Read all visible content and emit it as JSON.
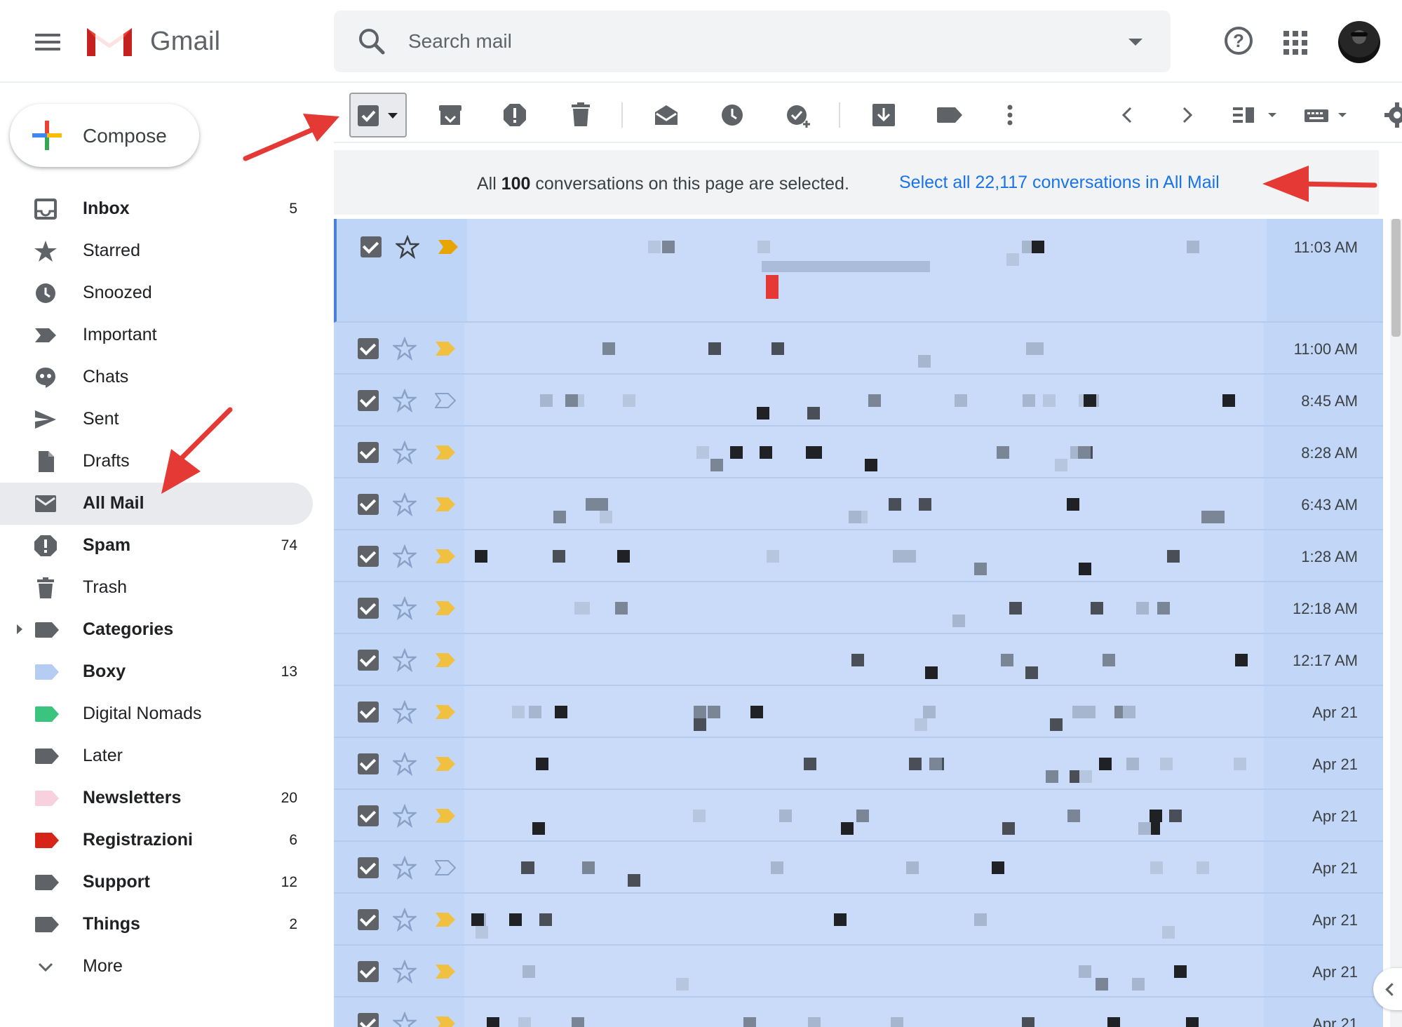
{
  "app": {
    "title": "Gmail"
  },
  "search": {
    "placeholder": "Search mail"
  },
  "compose": {
    "label": "Compose"
  },
  "sidebar": {
    "items": [
      {
        "label": "Inbox",
        "count": "5",
        "bold": true
      },
      {
        "label": "Starred",
        "count": ""
      },
      {
        "label": "Snoozed",
        "count": ""
      },
      {
        "label": "Important",
        "count": ""
      },
      {
        "label": "Chats",
        "count": ""
      },
      {
        "label": "Sent",
        "count": ""
      },
      {
        "label": "Drafts",
        "count": ""
      },
      {
        "label": "All Mail",
        "count": "",
        "bold": true,
        "active": true
      },
      {
        "label": "Spam",
        "count": "74",
        "bold": true
      },
      {
        "label": "Trash",
        "count": ""
      },
      {
        "label": "Categories",
        "count": "",
        "bold": true
      },
      {
        "label": "Boxy",
        "count": "13",
        "bold": true,
        "color": "#b5cdf3"
      },
      {
        "label": "Digital Nomads",
        "count": "",
        "color": "#3ac47d"
      },
      {
        "label": "Later",
        "count": "",
        "color": "#5f6368"
      },
      {
        "label": "Newsletters",
        "count": "20",
        "bold": true,
        "color": "#f7d1dd"
      },
      {
        "label": "Registrazioni",
        "count": "6",
        "bold": true,
        "color": "#d62518"
      },
      {
        "label": "Support",
        "count": "12",
        "bold": true,
        "color": "#5f6368"
      },
      {
        "label": "Things",
        "count": "2",
        "bold": true,
        "color": "#5f6368"
      },
      {
        "label": "More",
        "count": ""
      }
    ]
  },
  "toolbar": {
    "icons": [
      "select-all-checkbox",
      "archive-icon",
      "report-spam-icon",
      "delete-icon",
      "mark-read-icon",
      "snooze-icon",
      "add-to-tasks-icon",
      "move-to-icon",
      "label-icon",
      "more-icon",
      "newer-icon",
      "older-icon",
      "split-pane-icon",
      "input-tools-icon",
      "settings-icon"
    ]
  },
  "banner": {
    "prefix": "All ",
    "count": "100",
    "suffix": " conversations on this page are selected.",
    "select_all_link": "Select all 22,117 conversations in All Mail"
  },
  "messages": [
    {
      "time": "11:03 AM",
      "important": true,
      "important_color": "#e6a500"
    },
    {
      "time": "11:00 AM",
      "important": true,
      "important_color": "#f0c040"
    },
    {
      "time": "8:45 AM",
      "important": false
    },
    {
      "time": "8:28 AM",
      "important": true,
      "important_color": "#f0c040"
    },
    {
      "time": "6:43 AM",
      "important": true,
      "important_color": "#f0c040"
    },
    {
      "time": "1:28 AM",
      "important": true,
      "important_color": "#f0c040"
    },
    {
      "time": "12:18 AM",
      "important": true,
      "important_color": "#f0c040"
    },
    {
      "time": "12:17 AM",
      "important": true,
      "important_color": "#f0c040"
    },
    {
      "time": "Apr 21",
      "important": true,
      "important_color": "#f0c040"
    },
    {
      "time": "Apr 21",
      "important": true,
      "important_color": "#f0c040"
    },
    {
      "time": "Apr 21",
      "important": true,
      "important_color": "#f0c040"
    },
    {
      "time": "Apr 21",
      "important": false
    },
    {
      "time": "Apr 21",
      "important": true,
      "important_color": "#f0c040"
    },
    {
      "time": "Apr 21",
      "important": true,
      "important_color": "#f0c040"
    },
    {
      "time": "Apr 21",
      "important": true,
      "important_color": "#f0c040"
    }
  ],
  "colors": {
    "selected_row": "#c2d7f7",
    "link_blue": "#1a73e8",
    "annotation_red": "#e53935"
  }
}
